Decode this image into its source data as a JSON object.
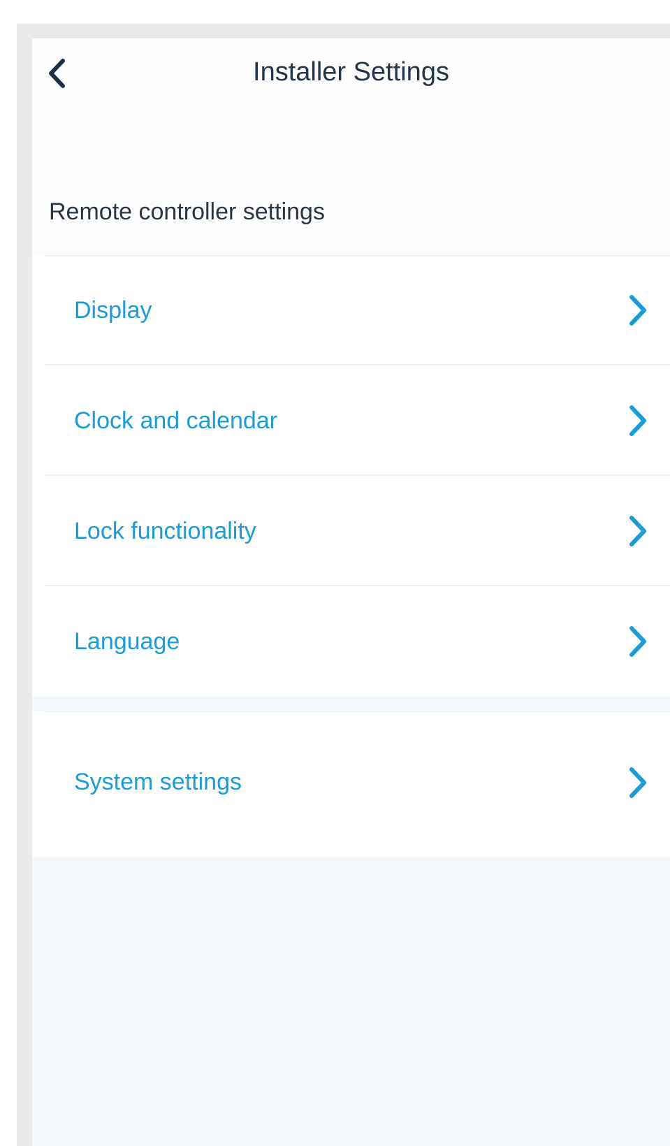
{
  "header": {
    "title": "Installer Settings",
    "back_icon": "chevron-left-icon"
  },
  "section": {
    "label": "Remote controller settings"
  },
  "menu": {
    "items": [
      {
        "label": "Display",
        "icon": "chevron-right-icon"
      },
      {
        "label": "Clock and calendar",
        "icon": "chevron-right-icon"
      },
      {
        "label": "Lock functionality",
        "icon": "chevron-right-icon"
      },
      {
        "label": "Language",
        "icon": "chevron-right-icon"
      }
    ],
    "secondary_items": [
      {
        "label": "System settings",
        "icon": "chevron-right-icon"
      }
    ]
  },
  "colors": {
    "accent": "#1a9cd8",
    "title_text": "#25364a",
    "background": "#f4f8fb"
  }
}
